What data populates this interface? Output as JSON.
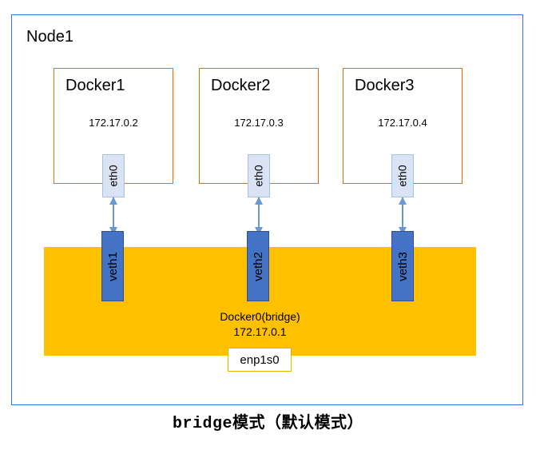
{
  "node": {
    "label": "Node1"
  },
  "dockers": [
    {
      "label": "Docker1",
      "ip": "172.17.0.2",
      "iface": "eth0"
    },
    {
      "label": "Docker2",
      "ip": "172.17.0.3",
      "iface": "eth0"
    },
    {
      "label": "Docker3",
      "ip": "172.17.0.4",
      "iface": "eth0"
    }
  ],
  "veths": [
    {
      "label": "veth1"
    },
    {
      "label": "veth2"
    },
    {
      "label": "veth3"
    }
  ],
  "bridge": {
    "name": "Docker0(bridge)",
    "ip": "172.17.0.1"
  },
  "phys_iface": {
    "label": "enp1s0"
  },
  "caption": "bridge模式（默认模式）",
  "colors": {
    "node_border": "#3a75c4",
    "docker_border": "#e86c0a",
    "bridge_bg": "#ffc000",
    "eth_bg": "#dae3f3",
    "veth_bg": "#4472c4",
    "arrow": "#6a98d0"
  }
}
